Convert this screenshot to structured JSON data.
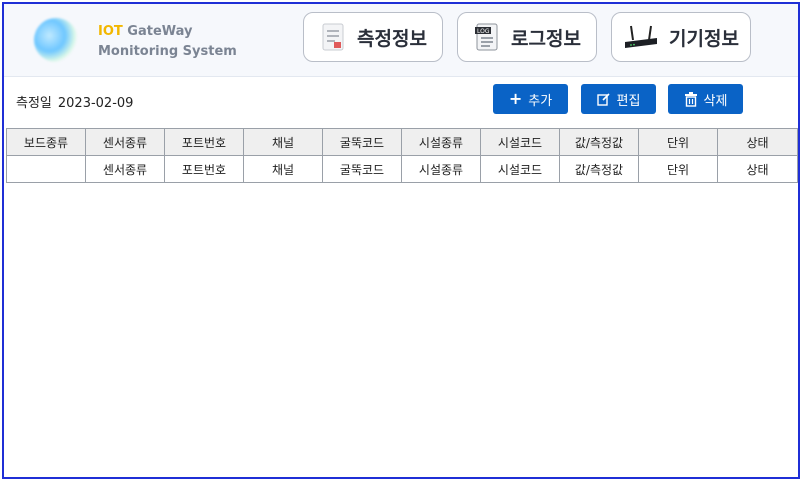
{
  "header": {
    "brand_line1_highlight": "IOT",
    "brand_line1_rest": " GateWay",
    "brand_line2": "Monitoring System",
    "nav": [
      {
        "label": "측정정보",
        "icon": "document-icon"
      },
      {
        "label": "로그정보",
        "icon": "log-file-icon"
      },
      {
        "label": "기기정보",
        "icon": "router-icon"
      }
    ]
  },
  "toolbar": {
    "date_label": "측정일",
    "date_value": "2023-02-09",
    "add_label": "추가",
    "edit_label": "편집",
    "delete_label": "삭제"
  },
  "table": {
    "columns": [
      "보드종류",
      "센서종류",
      "포트번호",
      "채널",
      "굴뚝코드",
      "시설종류",
      "시설코드",
      "값/측정값",
      "단위",
      "상태"
    ],
    "rows": [
      [
        "",
        "센서종류",
        "포트번호",
        "채널",
        "굴뚝코드",
        "시설종류",
        "시설코드",
        "값/측정값",
        "단위",
        "상태"
      ]
    ]
  },
  "colors": {
    "accent": "#0a63c6",
    "frame": "#1f2fd6",
    "brand_highlight": "#f2b700"
  }
}
